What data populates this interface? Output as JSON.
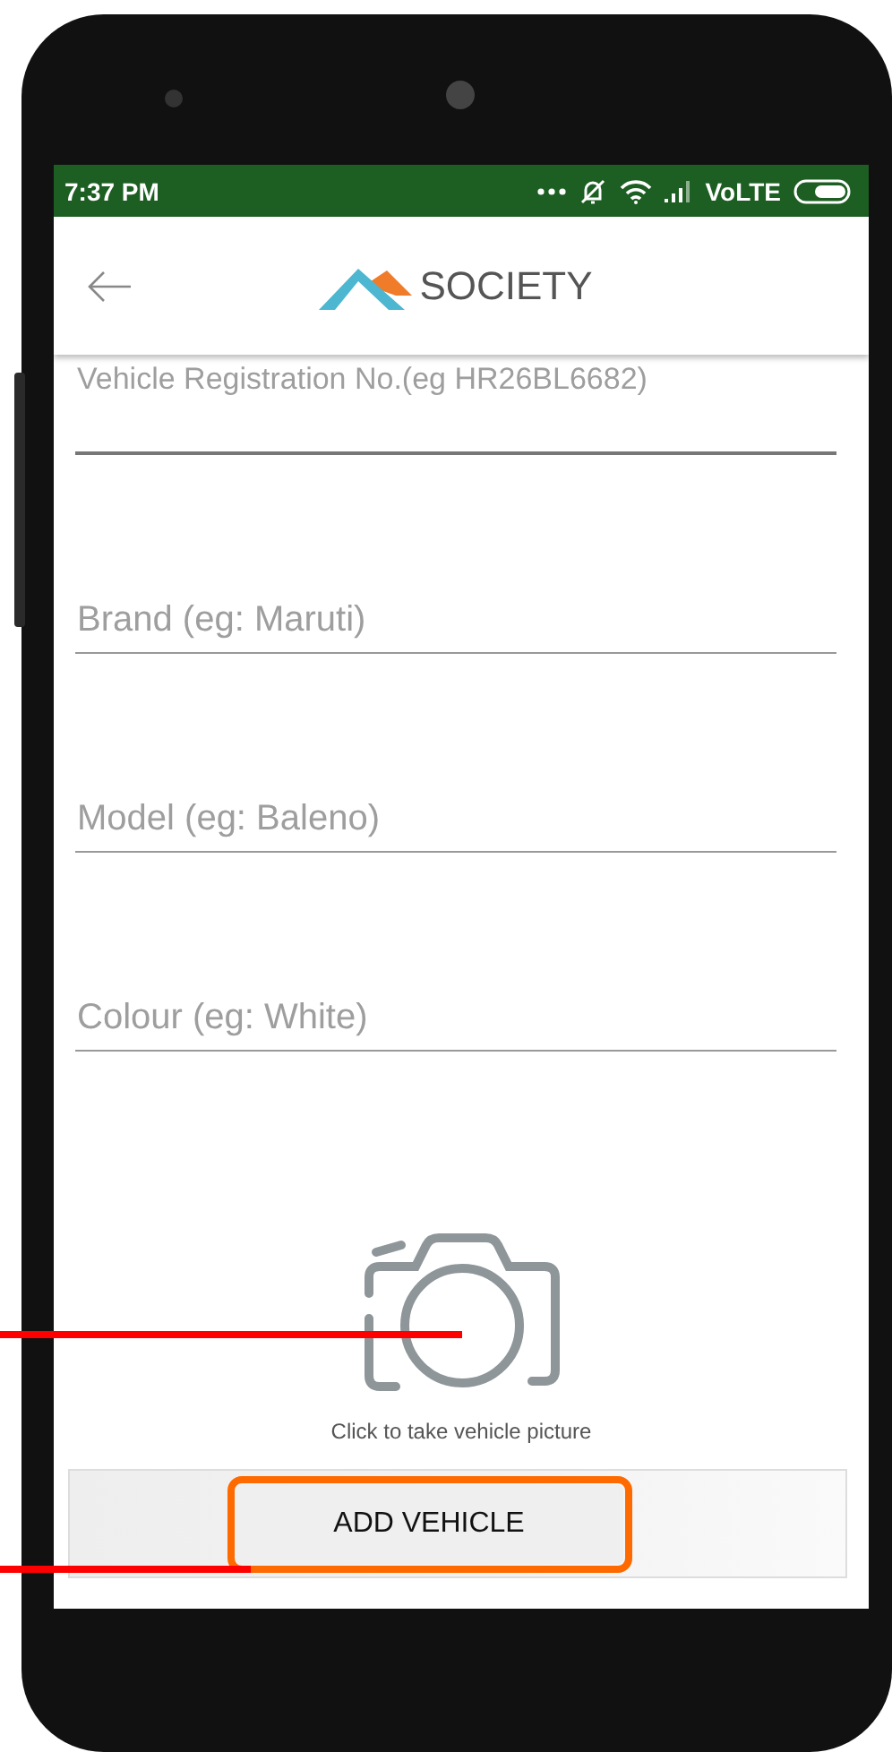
{
  "status_bar": {
    "time": "7:37 PM",
    "network": "VoLTE"
  },
  "header": {
    "logo_text": "SOCIETY"
  },
  "fields": [
    {
      "placeholder": "Vehicle Registration No.(eg HR26BL6682)",
      "focused": true
    },
    {
      "placeholder": "Brand (eg: Maruti)",
      "focused": false
    },
    {
      "placeholder": "Model (eg: Baleno)",
      "focused": false
    },
    {
      "placeholder": "Colour (eg: White)",
      "focused": false
    }
  ],
  "photo": {
    "caption": "Click to take vehicle picture"
  },
  "submit": {
    "label": "ADD VEHICLE",
    "highlighted": true
  }
}
